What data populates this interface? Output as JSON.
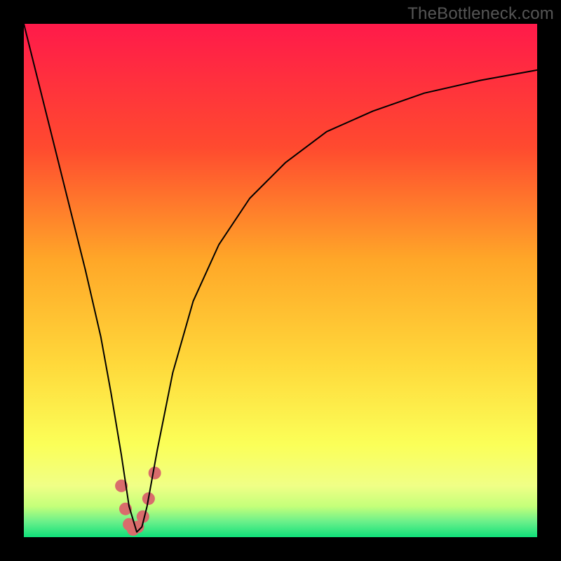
{
  "watermark": "TheBottleneck.com",
  "chart_data": {
    "type": "line",
    "title": "",
    "xlabel": "",
    "ylabel": "",
    "xlim": [
      0,
      100
    ],
    "ylim": [
      0,
      100
    ],
    "background_gradient": {
      "top": "#ff1a4a",
      "upper_mid": "#ff7a2a",
      "mid": "#ffd83a",
      "lower_mid": "#f7ff66",
      "green_band_top": "#a8ff6e",
      "bottom": "#10e07a"
    },
    "series": [
      {
        "name": "bottleneck-curve",
        "color": "#000000",
        "stroke_width": 2,
        "x": [
          0,
          3,
          6,
          9,
          12,
          15,
          17,
          19,
          20.5,
          22,
          23,
          24,
          26,
          29,
          33,
          38,
          44,
          51,
          59,
          68,
          78,
          89,
          100
        ],
        "y": [
          100,
          88,
          76,
          64,
          52,
          39,
          28,
          16,
          6,
          1,
          2,
          6,
          17,
          32,
          46,
          57,
          66,
          73,
          79,
          83,
          86.5,
          89,
          91
        ]
      },
      {
        "name": "highlight-dots",
        "color": "#d96c6c",
        "marker_radius": 9,
        "x": [
          19.0,
          19.8,
          20.5,
          21.3,
          22.2,
          23.2,
          24.3,
          25.5
        ],
        "y": [
          10.0,
          5.5,
          2.5,
          1.5,
          2.0,
          4.0,
          7.5,
          12.5
        ]
      }
    ]
  }
}
